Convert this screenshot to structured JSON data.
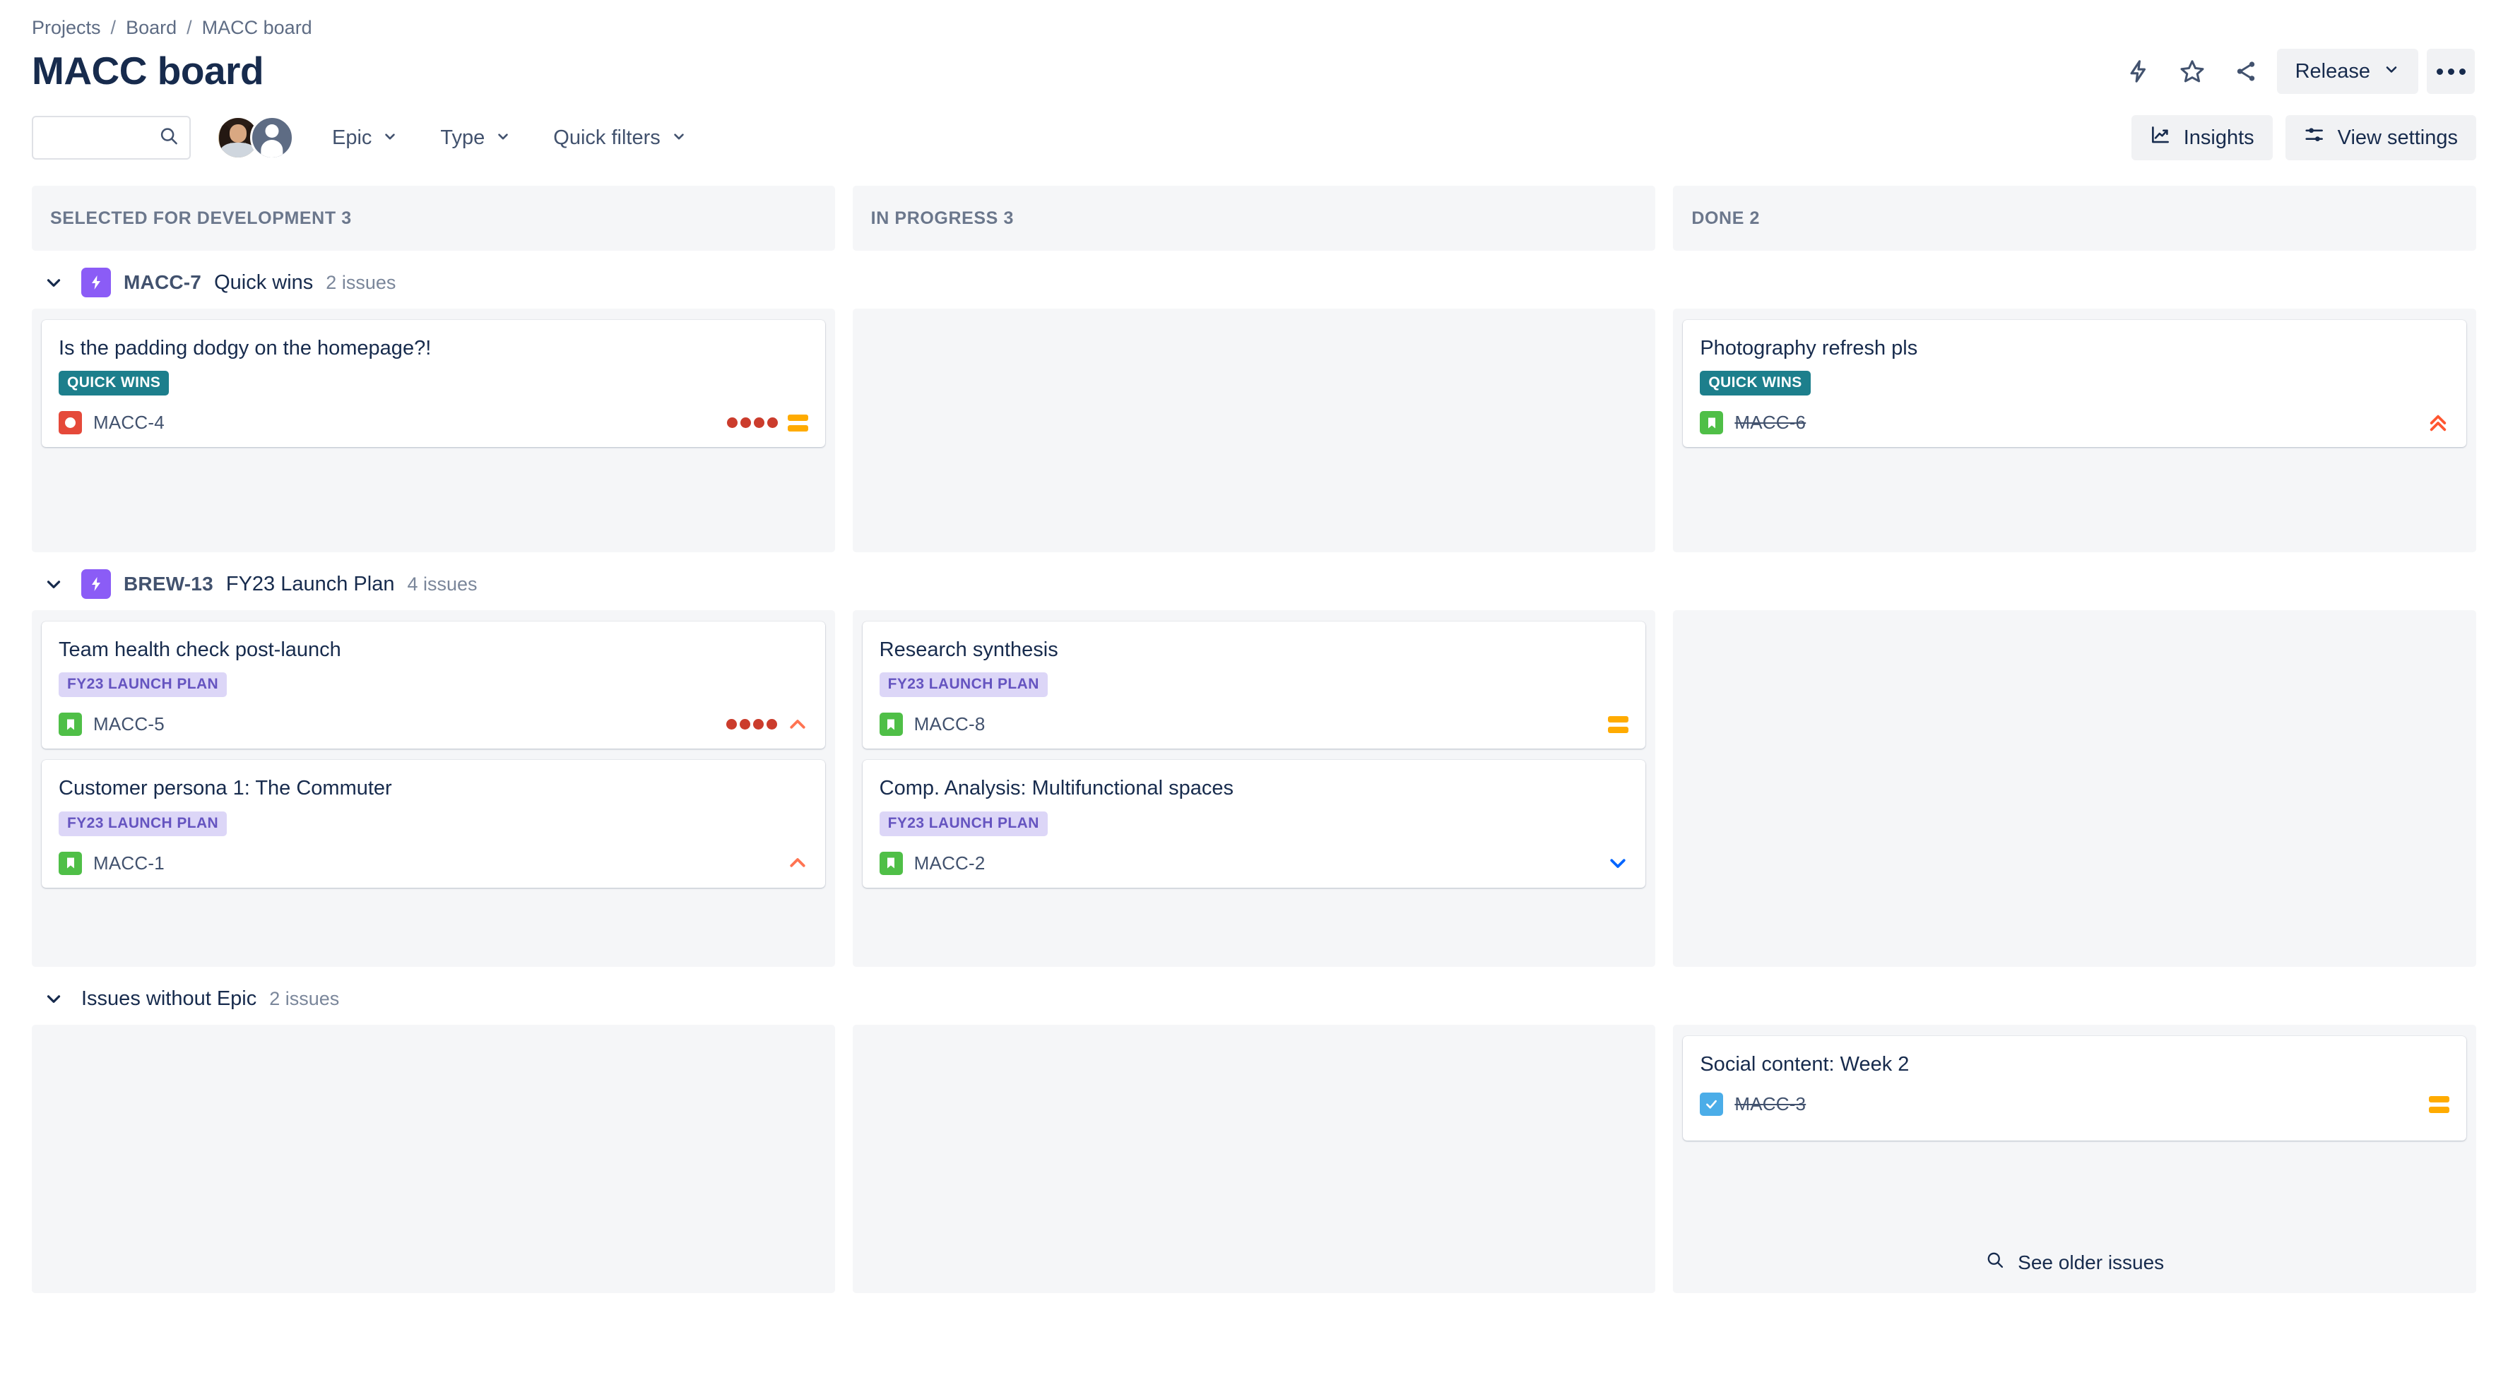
{
  "breadcrumb": {
    "projects": "Projects",
    "board": "Board",
    "current": "MACC board",
    "separator": "/"
  },
  "header": {
    "title": "MACC board",
    "release_label": "Release",
    "icons": {
      "lightning": "lightning-bolt-icon",
      "star": "star-icon",
      "share": "share-icon",
      "more": "more-options-icon"
    }
  },
  "filters": {
    "search_value": "",
    "search_placeholder": "",
    "epic_label": "Epic",
    "type_label": "Type",
    "quick_filters_label": "Quick filters",
    "insights_label": "Insights",
    "view_settings_label": "View settings"
  },
  "columns": [
    {
      "name": "SELECTED FOR DEVELOPMENT",
      "count": "3",
      "header": "SELECTED FOR DEVELOPMENT 3"
    },
    {
      "name": "IN PROGRESS",
      "count": "3",
      "header": "IN PROGRESS 3"
    },
    {
      "name": "DONE",
      "count": "2",
      "header": "DONE 2"
    }
  ],
  "swimlanes": [
    {
      "id": "quick-wins",
      "epic_key": "MACC-7",
      "epic_name": "Quick wins",
      "issue_count": "2 issues",
      "has_epic_icon": true,
      "cards": {
        "selected": [
          {
            "title": "Is the padding dodgy on the homepage?!",
            "label": "QUICK WINS",
            "label_style": "teal",
            "key": "MACC-4",
            "key_done": false,
            "type": "bug",
            "days_dots": 4,
            "priority": "medium"
          }
        ],
        "progress": [],
        "done": [
          {
            "title": "Photography refresh pls",
            "label": "QUICK WINS",
            "label_style": "teal",
            "key": "MACC-6",
            "key_done": true,
            "type": "story",
            "days_dots": 0,
            "priority": "highest"
          }
        ]
      }
    },
    {
      "id": "fy23-launch-plan",
      "epic_key": "BREW-13",
      "epic_name": "FY23 Launch Plan",
      "issue_count": "4 issues",
      "has_epic_icon": true,
      "cards": {
        "selected": [
          {
            "title": "Team health check post-launch",
            "label": "FY23 LAUNCH PLAN",
            "label_style": "purple",
            "key": "MACC-5",
            "key_done": false,
            "type": "story",
            "days_dots": 4,
            "priority": "high"
          },
          {
            "title": "Customer persona 1: The Commuter",
            "label": "FY23 LAUNCH PLAN",
            "label_style": "purple",
            "key": "MACC-1",
            "key_done": false,
            "type": "story",
            "days_dots": 0,
            "priority": "high"
          }
        ],
        "progress": [
          {
            "title": "Research synthesis",
            "label": "FY23 LAUNCH PLAN",
            "label_style": "purple",
            "key": "MACC-8",
            "key_done": false,
            "type": "story",
            "days_dots": 0,
            "priority": "medium"
          },
          {
            "title": "Comp. Analysis: Multifunctional spaces",
            "label": "FY23 LAUNCH PLAN",
            "label_style": "purple",
            "key": "MACC-2",
            "key_done": false,
            "type": "story",
            "days_dots": 0,
            "priority": "low"
          }
        ],
        "done": []
      }
    },
    {
      "id": "issues-without-epic",
      "epic_key": "",
      "epic_name": "Issues without Epic",
      "issue_count": "2 issues",
      "has_epic_icon": false,
      "cards": {
        "selected": [],
        "progress": [],
        "done": [
          {
            "title": "Social content: Week 2",
            "label": "",
            "label_style": "",
            "key": "MACC-3",
            "key_done": true,
            "type": "task",
            "days_dots": 0,
            "priority": "medium"
          }
        ]
      }
    }
  ],
  "footer": {
    "see_older_label": "See older issues"
  },
  "colors": {
    "epic_purple": "#8b5cf6",
    "label_teal": "#1d7f8c",
    "label_purple_bg": "#dcd6f7",
    "label_purple_text": "#6554c0",
    "bug_red": "#e5493a",
    "story_green": "#4fbf47",
    "task_blue": "#4bade8",
    "priority_medium": "#ffab00",
    "priority_high": "#ff7452",
    "priority_highest": "#ff5630",
    "priority_low": "#0065ff",
    "days_dot": "#cb3c2c",
    "column_bg": "#f5f6f8",
    "text_primary": "#172b4d",
    "text_subtle": "#6b778c"
  }
}
